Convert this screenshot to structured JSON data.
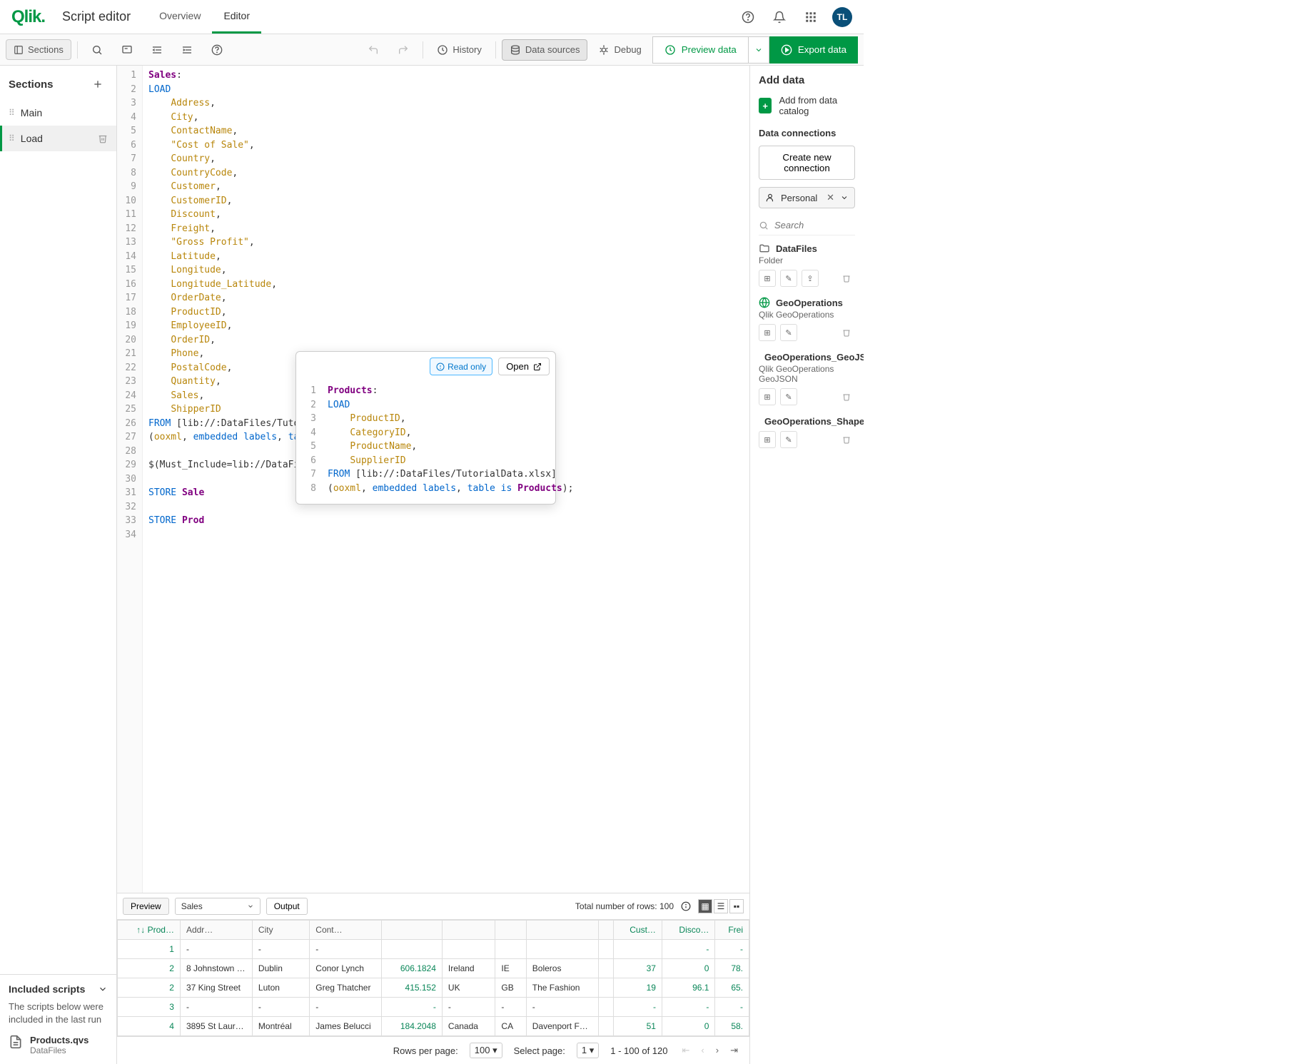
{
  "header": {
    "logo": "Qlik",
    "app_name": "Script editor",
    "tabs": [
      {
        "label": "Overview",
        "active": false
      },
      {
        "label": "Editor",
        "active": true
      }
    ],
    "avatar": "TL"
  },
  "toolbar": {
    "sections_label": "Sections",
    "history_label": "History",
    "data_sources_label": "Data sources",
    "debug_label": "Debug",
    "preview_label": "Preview data",
    "export_label": "Export data"
  },
  "sidebar": {
    "title": "Sections",
    "items": [
      {
        "label": "Main",
        "active": false
      },
      {
        "label": "Load",
        "active": true
      }
    ],
    "included_title": "Included scripts",
    "included_desc": "The scripts below were included in the last run",
    "included_file": {
      "name": "Products.qvs",
      "source": "DataFiles"
    }
  },
  "editor": {
    "lines": [
      {
        "n": 1,
        "html": "<span class='tbl'>Sales</span>:"
      },
      {
        "n": 2,
        "html": "<span class='kw'>LOAD</span>"
      },
      {
        "n": 3,
        "html": "    <span class='field'>Address</span>,"
      },
      {
        "n": 4,
        "html": "    <span class='field'>City</span>,"
      },
      {
        "n": 5,
        "html": "    <span class='field'>ContactName</span>,"
      },
      {
        "n": 6,
        "html": "    <span class='field'>\"Cost of Sale\"</span>,"
      },
      {
        "n": 7,
        "html": "    <span class='field'>Country</span>,"
      },
      {
        "n": 8,
        "html": "    <span class='field'>CountryCode</span>,"
      },
      {
        "n": 9,
        "html": "    <span class='field'>Customer</span>,"
      },
      {
        "n": 10,
        "html": "    <span class='field'>CustomerID</span>,"
      },
      {
        "n": 11,
        "html": "    <span class='field'>Discount</span>,"
      },
      {
        "n": 12,
        "html": "    <span class='field'>Freight</span>,"
      },
      {
        "n": 13,
        "html": "    <span class='field'>\"Gross Profit\"</span>,"
      },
      {
        "n": 14,
        "html": "    <span class='field'>Latitude</span>,"
      },
      {
        "n": 15,
        "html": "    <span class='field'>Longitude</span>,"
      },
      {
        "n": 16,
        "html": "    <span class='field'>Longitude_Latitude</span>,"
      },
      {
        "n": 17,
        "html": "    <span class='field'>OrderDate</span>,"
      },
      {
        "n": 18,
        "html": "    <span class='field'>ProductID</span>,"
      },
      {
        "n": 19,
        "html": "    <span class='field'>EmployeeID</span>,"
      },
      {
        "n": 20,
        "html": "    <span class='field'>OrderID</span>,"
      },
      {
        "n": 21,
        "html": "    <span class='field'>Phone</span>,"
      },
      {
        "n": 22,
        "html": "    <span class='field'>PostalCode</span>,"
      },
      {
        "n": 23,
        "html": "    <span class='field'>Quantity</span>,"
      },
      {
        "n": 24,
        "html": "    <span class='field'>Sales</span>,"
      },
      {
        "n": 25,
        "html": "    <span class='field'>ShipperID</span>"
      },
      {
        "n": 26,
        "html": "<span class='kw'>FROM</span> [lib://:DataFiles/TutorialData.xlsx]"
      },
      {
        "n": 27,
        "html": "(<span class='field'>ooxml</span>, <span class='kw'>embedded labels</span>, <span class='kw'>table is</span> <span class='tbl'>Sales</span>);"
      },
      {
        "n": 28,
        "html": ""
      },
      {
        "n": 29,
        "html": "$(Must_Include=lib://DataFiles/Products.qvs) <span style='border:1px solid #ccc;border-radius:3px;padding:0 3px;color:#888;font-size:11px;'>&lt;/&gt;</span>"
      },
      {
        "n": 30,
        "html": ""
      },
      {
        "n": 31,
        "html": "<span class='kw'>STORE</span> <span class='tbl'>Sale</span>"
      },
      {
        "n": 32,
        "html": ""
      },
      {
        "n": 33,
        "html": "<span class='kw'>STORE</span> <span class='tbl'>Prod</span>"
      },
      {
        "n": 34,
        "html": ""
      }
    ]
  },
  "popup": {
    "readonly_label": "Read only",
    "open_label": "Open",
    "lines": [
      {
        "n": 1,
        "html": "<span class='tbl'>Products</span>:"
      },
      {
        "n": 2,
        "html": "<span class='kw'>LOAD</span>"
      },
      {
        "n": 3,
        "html": "    <span class='field'>ProductID</span>,"
      },
      {
        "n": 4,
        "html": "    <span class='field'>CategoryID</span>,"
      },
      {
        "n": 5,
        "html": "    <span class='field'>ProductName</span>,"
      },
      {
        "n": 6,
        "html": "    <span class='field'>SupplierID</span>"
      },
      {
        "n": 7,
        "html": "<span class='kw'>FROM</span> [lib://:DataFiles/TutorialData.xlsx]"
      },
      {
        "n": 8,
        "html": "(<span class='field'>ooxml</span>, <span class='kw'>embedded labels</span>, <span class='kw'>table is</span> <span class='tbl'>Products</span>);"
      }
    ]
  },
  "right_panel": {
    "title": "Add data",
    "add_catalog": "Add from data catalog",
    "connections_title": "Data connections",
    "create_label": "Create new connection",
    "personal_label": "Personal",
    "search_placeholder": "Search",
    "items": [
      {
        "name": "DataFiles",
        "sub": "Folder",
        "icon": "folder"
      },
      {
        "name": "GeoOperations",
        "sub": "Qlik GeoOperations",
        "icon": "globe"
      },
      {
        "name": "GeoOperations_GeoJSON",
        "sub": "Qlik GeoOperations GeoJSON",
        "icon": "globe"
      },
      {
        "name": "GeoOperations_Shapefile",
        "sub": "",
        "icon": "globe"
      }
    ]
  },
  "bottom": {
    "preview_label": "Preview",
    "output_label": "Output",
    "table_select": "Sales",
    "total_rows_label": "Total number of rows: 100",
    "columns": [
      "Prod…",
      "Addr…",
      "City",
      "Cont…",
      "",
      "",
      "",
      "",
      "",
      "Cust…",
      "Disco…",
      "Frei"
    ],
    "rows": [
      [
        "1",
        "-",
        "-",
        "-",
        "",
        "",
        "",
        "",
        "",
        "",
        "-",
        "-"
      ],
      [
        "2",
        "8 Johnstown R…",
        "Dublin",
        "Conor Lynch",
        "606.1824",
        "Ireland",
        "IE",
        "Boleros",
        "",
        "37",
        "0",
        "78."
      ],
      [
        "2",
        "37 King Street",
        "Luton",
        "Greg Thatcher",
        "415.152",
        "UK",
        "GB",
        "The Fashion",
        "",
        "19",
        "96.1",
        "65."
      ],
      [
        "3",
        "-",
        "-",
        "-",
        "-",
        "-",
        "-",
        "-",
        "",
        "-",
        "-",
        "-"
      ],
      [
        "4",
        "3895 St Lauren…",
        "Montréal",
        "James Belucci",
        "184.2048",
        "Canada",
        "CA",
        "Davenport Fas…",
        "",
        "51",
        "0",
        "58."
      ]
    ],
    "rows_per_page_label": "Rows per page:",
    "rows_per_page_value": "100",
    "select_page_label": "Select page:",
    "select_page_value": "1",
    "range_label": "1 - 100 of 120"
  }
}
